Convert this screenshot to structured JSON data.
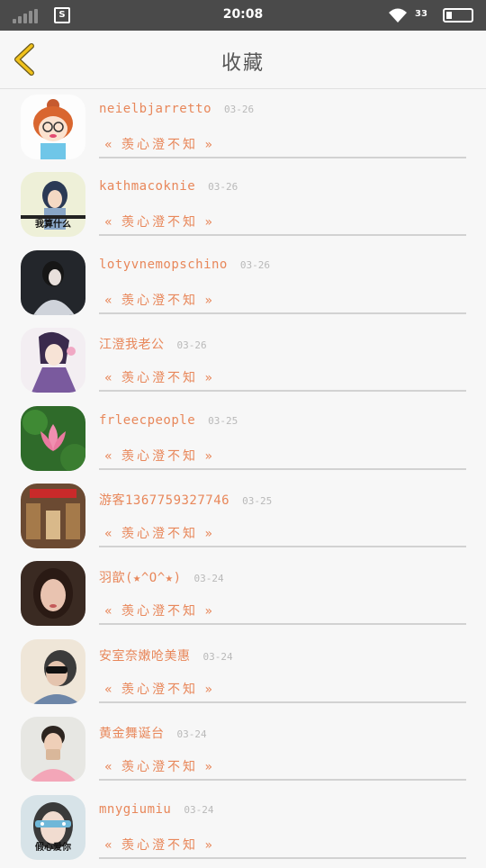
{
  "status": {
    "time": "20:08",
    "network": "33"
  },
  "header": {
    "title": "收藏"
  },
  "message_text": "« 羡心澄不知 »",
  "items": [
    {
      "name": "neielbjarretto",
      "date": "03-26",
      "avatar": "cartoon-girl-avatar",
      "caption": ""
    },
    {
      "name": "kathmacoknie",
      "date": "03-26",
      "avatar": "girl-photo-avatar",
      "caption": "我算什么"
    },
    {
      "name": "lotyvnemopschino",
      "date": "03-26",
      "avatar": "costume-avatar",
      "caption": ""
    },
    {
      "name": "江澄我老公",
      "date": "03-26",
      "avatar": "anime-character-avatar",
      "caption": ""
    },
    {
      "name": "frleecpeople",
      "date": "03-25",
      "avatar": "lotus-avatar",
      "caption": ""
    },
    {
      "name": "游客1367759327746",
      "date": "03-25",
      "avatar": "shop-photo-avatar",
      "caption": ""
    },
    {
      "name": "羽歆(★^O^★)",
      "date": "03-24",
      "avatar": "girl-portrait-avatar",
      "caption": ""
    },
    {
      "name": "安室奈嫩呛美惠",
      "date": "03-24",
      "avatar": "sunglasses-avatar",
      "caption": ""
    },
    {
      "name": "黄金舞诞台",
      "date": "03-24",
      "avatar": "boy-photo-avatar",
      "caption": ""
    },
    {
      "name": "mnygiumiu",
      "date": "03-24",
      "avatar": "masked-girl-avatar",
      "caption": "假心爱你"
    }
  ]
}
